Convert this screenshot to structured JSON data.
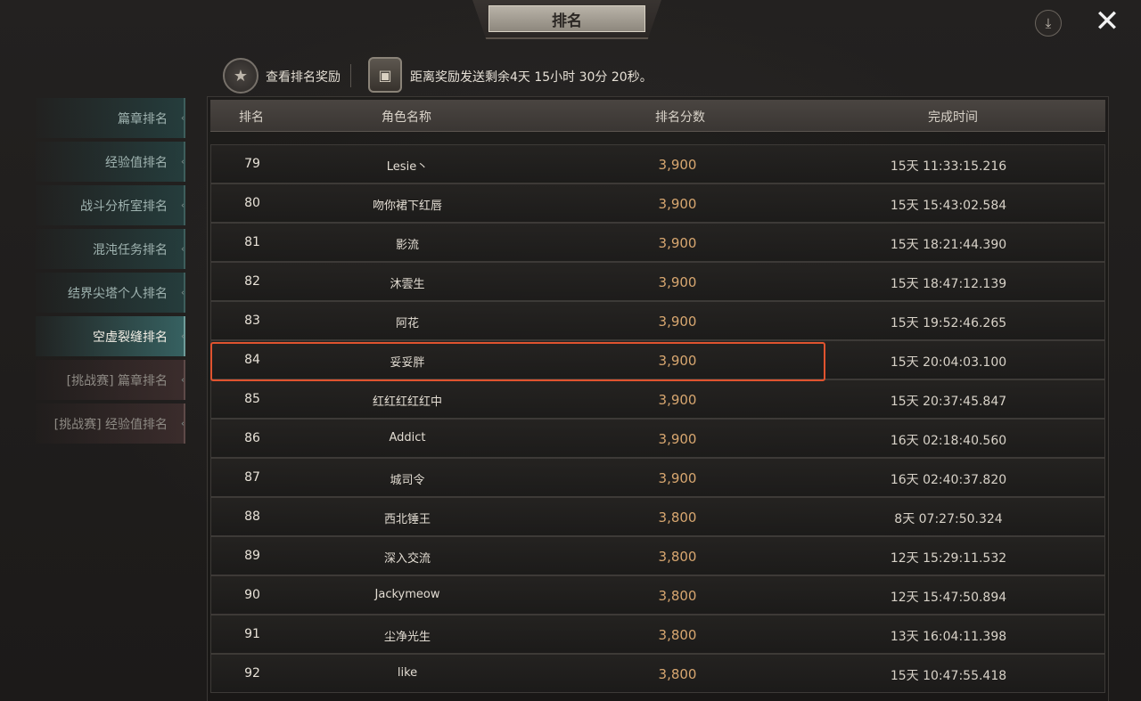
{
  "header": {
    "title": "排名",
    "download_icon": "download-arrow-icon",
    "close_icon": "close-x-icon"
  },
  "info": {
    "reward_label": "查看排名奖励",
    "countdown": "距离奖励发送剩余4天 15小时 30分 20秒。"
  },
  "sidebar": {
    "items": [
      {
        "label": "篇章排名"
      },
      {
        "label": "经验值排名"
      },
      {
        "label": "战斗分析室排名"
      },
      {
        "label": "混沌任务排名"
      },
      {
        "label": "结界尖塔个人排名"
      },
      {
        "label": "空虚裂缝排名"
      },
      {
        "label": "[挑战赛] 篇章排名"
      },
      {
        "label": "[挑战赛] 经验值排名"
      }
    ],
    "active_index": 5
  },
  "table": {
    "columns": [
      "排名",
      "角色名称",
      "排名分数",
      "完成时间"
    ],
    "rows": [
      {
        "rank": "79",
        "name": "Lesie丶",
        "score": "3,900",
        "time": "15天 11:33:15.216"
      },
      {
        "rank": "80",
        "name": "吻你裙下红唇",
        "score": "3,900",
        "time": "15天 15:43:02.584"
      },
      {
        "rank": "81",
        "name": "影流",
        "score": "3,900",
        "time": "15天 18:21:44.390"
      },
      {
        "rank": "82",
        "name": "沐雲生",
        "score": "3,900",
        "time": "15天 18:47:12.139"
      },
      {
        "rank": "83",
        "name": "阿花",
        "score": "3,900",
        "time": "15天 19:52:46.265"
      },
      {
        "rank": "84",
        "name": "妥妥胖",
        "score": "3,900",
        "time": "15天 20:04:03.100"
      },
      {
        "rank": "85",
        "name": "红红红红红中",
        "score": "3,900",
        "time": "15天 20:37:45.847"
      },
      {
        "rank": "86",
        "name": "Addict",
        "score": "3,900",
        "time": "16天 02:18:40.560"
      },
      {
        "rank": "87",
        "name": "城司令",
        "score": "3,900",
        "time": "16天 02:40:37.820"
      },
      {
        "rank": "88",
        "name": "西北锤王",
        "score": "3,800",
        "time": "8天 07:27:50.324"
      },
      {
        "rank": "89",
        "name": "深入交流",
        "score": "3,800",
        "time": "12天 15:29:11.532"
      },
      {
        "rank": "90",
        "name": "Jackymeow",
        "score": "3,800",
        "time": "12天 15:47:50.894"
      },
      {
        "rank": "91",
        "name": "尘净光生",
        "score": "3,800",
        "time": "13天 16:04:11.398"
      },
      {
        "rank": "92",
        "name": "like",
        "score": "3,800",
        "time": "15天 10:47:55.418"
      }
    ],
    "highlighted_rank": "84"
  },
  "colors": {
    "score": "#d8a770",
    "highlight_border": "#e0532f",
    "active_tab": "#376464"
  }
}
